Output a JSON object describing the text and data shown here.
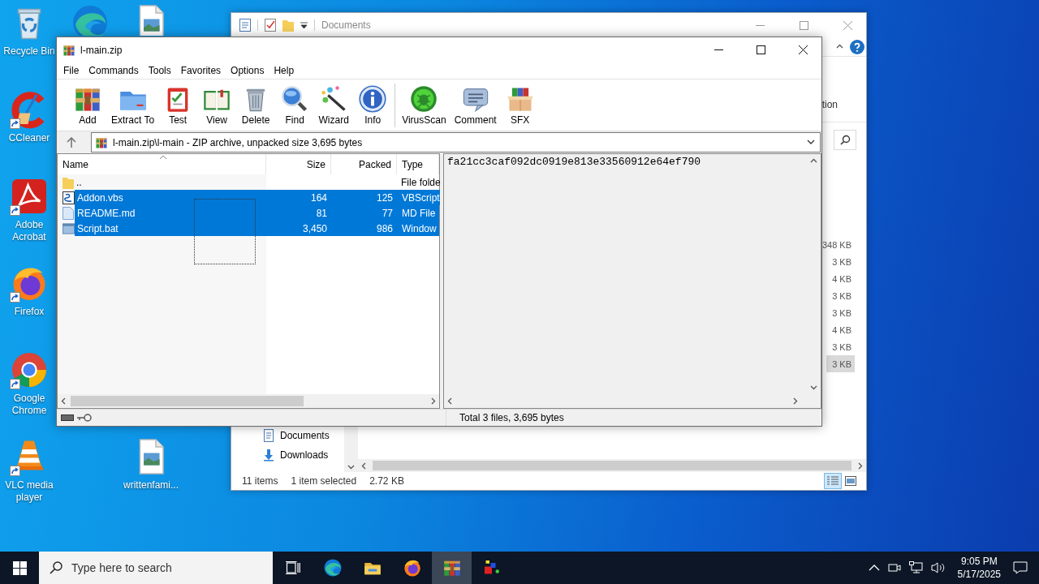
{
  "desktop": {
    "icons": [
      {
        "kind": "recycle-bin",
        "label": "Recycle Bin",
        "shortcut": false
      },
      {
        "kind": "edge",
        "shortcut": false
      },
      {
        "kind": "image-file",
        "shortcut": false
      },
      {
        "kind": "ccleaner",
        "label": "CCleaner",
        "shortcut": true
      },
      {
        "kind": "acrobat",
        "label": "Adobe Acrobat",
        "shortcut": true
      },
      {
        "kind": "firefox",
        "label": "Firefox",
        "shortcut": true
      },
      {
        "kind": "chrome",
        "label": "Google Chrome",
        "shortcut": true
      },
      {
        "kind": "vlc",
        "label": "VLC media player",
        "shortcut": true
      },
      {
        "kind": "image-file",
        "label": "writtenfami...",
        "shortcut": false
      }
    ]
  },
  "explorer_window": {
    "title": "Documents",
    "ribbon_text": "tion",
    "nav_items": [
      {
        "kind": "documents",
        "label": "Documents"
      },
      {
        "kind": "downloads",
        "label": "Downloads"
      }
    ],
    "file_sizes": [
      {
        "size": "348 KB",
        "selected": false
      },
      {
        "size": "3 KB",
        "selected": false
      },
      {
        "size": "4 KB",
        "selected": false
      },
      {
        "size": "3 KB",
        "selected": false
      },
      {
        "size": "3 KB",
        "selected": false
      },
      {
        "size": "4 KB",
        "selected": false
      },
      {
        "size": "3 KB",
        "selected": false
      },
      {
        "size": "3 KB",
        "selected": true
      }
    ],
    "status_bar": {
      "items": "11 items",
      "selection": "1 item selected",
      "size": "2.72 KB"
    },
    "view_buttons": [
      {
        "kind": "details",
        "selected": true
      },
      {
        "kind": "preview",
        "selected": false
      }
    ]
  },
  "archive_window": {
    "title": "l-main.zip",
    "menu": [
      "File",
      "Commands",
      "Tools",
      "Favorites",
      "Options",
      "Help"
    ],
    "toolbar": [
      {
        "kind": "add",
        "label": "Add"
      },
      {
        "kind": "extract",
        "label": "Extract To"
      },
      {
        "kind": "test",
        "label": "Test"
      },
      {
        "kind": "view",
        "label": "View"
      },
      {
        "kind": "delete",
        "label": "Delete"
      },
      {
        "kind": "find",
        "label": "Find"
      },
      {
        "kind": "wizard",
        "label": "Wizard"
      },
      {
        "kind": "info",
        "label": "Info"
      },
      {
        "kind": "separator"
      },
      {
        "kind": "virusscan",
        "label": "VirusScan"
      },
      {
        "kind": "comment",
        "label": "Comment"
      },
      {
        "kind": "sfx",
        "label": "SFX"
      }
    ],
    "path": "l-main.zip\\l-main - ZIP archive, unpacked size 3,695 bytes",
    "columns": [
      "Name",
      "Size",
      "Packed",
      "Type"
    ],
    "rows": [
      {
        "kind": "folder",
        "name": "..",
        "type": "File folde",
        "selected": false
      },
      {
        "kind": "script",
        "name": "Addon.vbs",
        "size": "164",
        "packed": "125",
        "type": "VBScript",
        "selected": true
      },
      {
        "kind": "document",
        "name": "README.md",
        "size": "81",
        "packed": "77",
        "type": "MD File",
        "selected": true
      },
      {
        "kind": "batch",
        "name": "Script.bat",
        "size": "3,450",
        "packed": "986",
        "type": "Window",
        "selected": true
      }
    ],
    "comment": "fa21cc3caf092dc0919e813e33560912e64ef790",
    "status_bar": "Total 3 files, 3,695 bytes"
  },
  "taskbar": {
    "placeholder": "Type here to search",
    "apps": [
      {
        "kind": "task-view",
        "selected": false
      },
      {
        "kind": "edge",
        "selected": false
      },
      {
        "kind": "explorer",
        "selected": false
      },
      {
        "kind": "firefox",
        "selected": false
      },
      {
        "kind": "winrar",
        "selected": true
      },
      {
        "kind": "app",
        "selected": false
      }
    ],
    "time": "9:05 PM",
    "date": "5/17/2025"
  }
}
